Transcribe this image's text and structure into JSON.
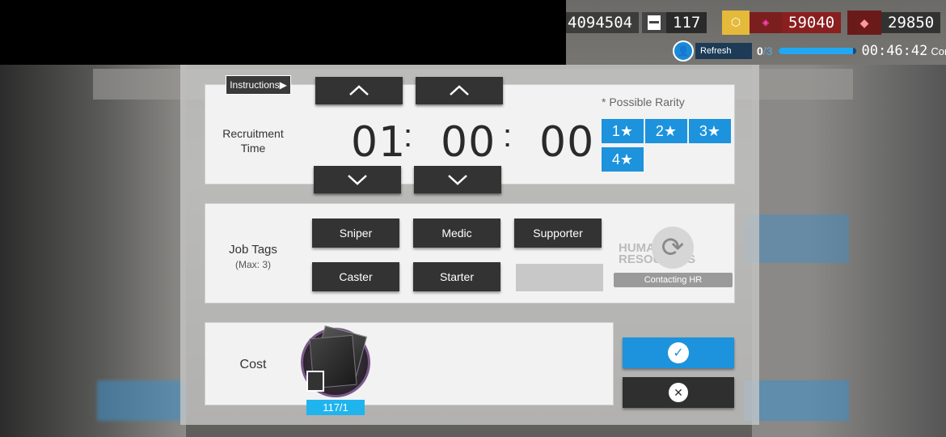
{
  "topbar": {
    "lmd": "4094504",
    "permits": "117",
    "originium": "59040",
    "orundum": "29850",
    "refresh_label": "Refresh",
    "refresh_count": "0",
    "refresh_max": "/3",
    "refresh_progress": 0.95,
    "timer": "00:46:42",
    "status": "Contacting"
  },
  "recruit": {
    "instructions_label": "Instructions",
    "time_label": "Recruitment Time",
    "hours": "01",
    "minutes": "00",
    "seconds": "00",
    "colon": ":",
    "rarity_title": "* Possible Rarity",
    "rarities": [
      "1★",
      "2★",
      "3★",
      "4★"
    ]
  },
  "job_tags": {
    "title": "Job Tags",
    "subtitle": "(Max: 3)",
    "tags": [
      "Sniper",
      "Medic",
      "Supporter",
      "Caster",
      "Starter"
    ],
    "hr_art_text": "HUMAN RESOURCES",
    "hr_button": "Contacting HR"
  },
  "cost": {
    "label": "Cost",
    "count": "117/1"
  },
  "colors": {
    "accent_blue": "#1c93dc",
    "dark_button": "#333333",
    "cost_blue": "#1fb4ee"
  }
}
